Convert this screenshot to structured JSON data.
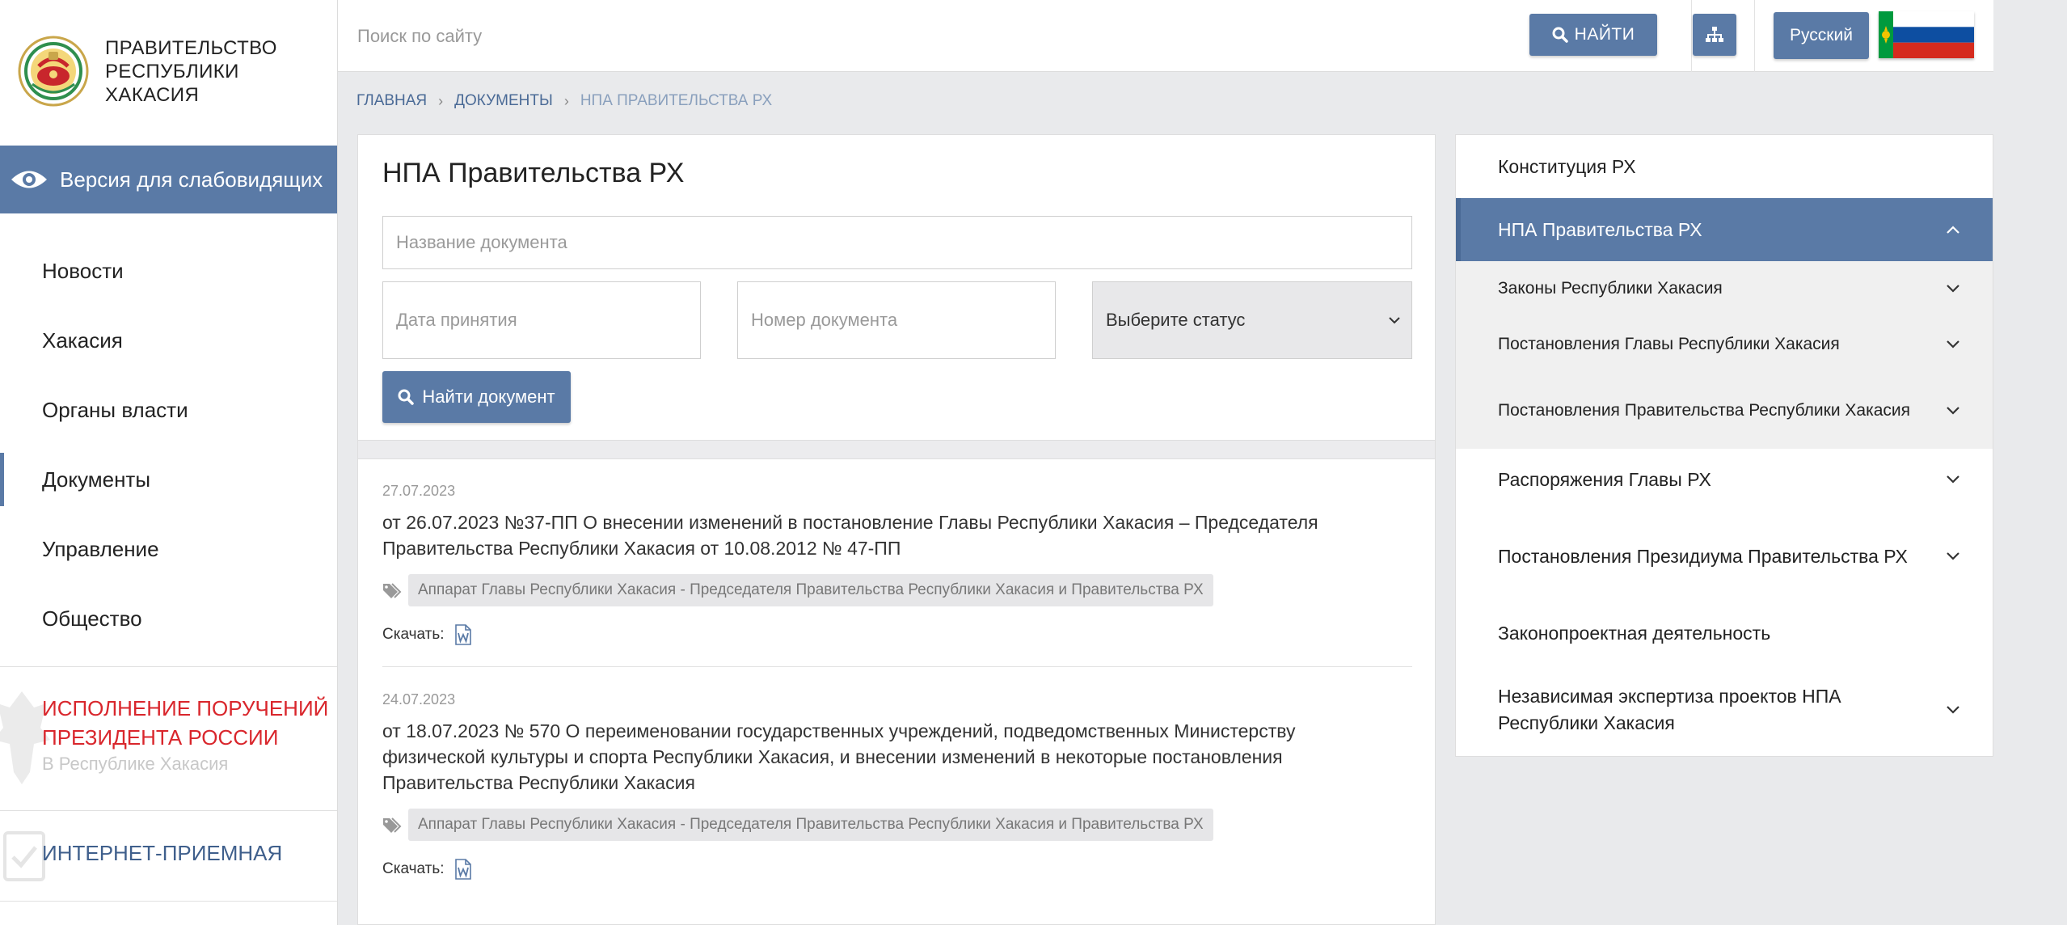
{
  "colors": {
    "accent": "#5a7aa6",
    "accent_dark": "#4a6a96",
    "alert_red": "#d9262c",
    "page_bg": "#e9eaec"
  },
  "brand": {
    "name": "ПРАВИТЕЛЬСТВО РЕСПУБЛИКИ ХАКАСИЯ",
    "line1": "ПРАВИТЕЛЬСТВО",
    "line2": "РЕСПУБЛИКИ",
    "line3": "ХАКАСИЯ",
    "icon": "coat-of-arms-icon"
  },
  "accessibility": {
    "label": "Версия для слабовидящих",
    "icon": "eye-icon"
  },
  "nav": {
    "items": [
      {
        "label": "Новости"
      },
      {
        "label": "Хакасия"
      },
      {
        "label": "Органы власти"
      },
      {
        "label": "Документы",
        "active": true
      },
      {
        "label": "Управление"
      },
      {
        "label": "Общество"
      }
    ]
  },
  "promo": {
    "title_line1": "ИСПОЛНЕНИЕ ПОРУЧЕНИЙ",
    "title_line2": "ПРЕЗИДЕНТА РОССИИ",
    "subtitle": "В Республике Хакасия"
  },
  "reception": {
    "label": "ИНТЕРНЕТ-ПРИЕМНАЯ"
  },
  "header": {
    "search_placeholder": "Поиск по сайту",
    "find_label": "НАЙТИ",
    "language": "Русский",
    "flag_colors": [
      "#ffffff",
      "#0d4ea1",
      "#d52b1e",
      "#009a3e",
      "#f4c300"
    ]
  },
  "breadcrumb": {
    "home": "ГЛАВНАЯ",
    "documents": "ДОКУМЕНТЫ",
    "current": "НПА ПРАВИТЕЛЬСТВА РХ"
  },
  "main": {
    "title": "НПА Правительства РХ",
    "filters": {
      "name_placeholder": "Название документа",
      "date_placeholder": "Дата принятия",
      "number_placeholder": "Номер документа",
      "status_selected": "Выберите статус",
      "submit_label": "Найти документ"
    },
    "documents": [
      {
        "date": "27.07.2023",
        "title": "от 26.07.2023 №37-ПП О внесении изменений в постановление Главы Республики Хакасия – Председателя Правительства Республики Хакасия от 10.08.2012 № 47-ПП",
        "tag": "Аппарат Главы Республики Хакасия - Председателя Правительства Республики Хакасия и Правительства РХ",
        "download_label": "Скачать:"
      },
      {
        "date": "24.07.2023",
        "title": "от 18.07.2023 № 570 О переименовании государственных учреждений, подведомственных Министерству физической культуры и спорта Республики Хакасия, и внесении изменений в некоторые постановления Правительства Республики Хакасия",
        "tag": "Аппарат Главы Республики Хакасия - Председателя Правительства Республики Хакасия и Правительства РХ",
        "download_label": "Скачать:"
      }
    ]
  },
  "right_menu": {
    "items": [
      {
        "label": "Конституция РХ"
      },
      {
        "label": "НПА Правительства РХ",
        "active": true,
        "children": [
          {
            "label": "Законы Республики Хакасия"
          },
          {
            "label": "Постановления Главы Республики Хакасия"
          },
          {
            "label": "Постановления Правительства Республики Хакасия"
          }
        ]
      },
      {
        "label": "Распоряжения Главы РХ"
      },
      {
        "label": "Постановления Президиума Правительства РХ"
      },
      {
        "label": "Законопроектная деятельность"
      },
      {
        "label": "Независимая экспертиза проектов НПА Республики Хакасия"
      }
    ]
  }
}
